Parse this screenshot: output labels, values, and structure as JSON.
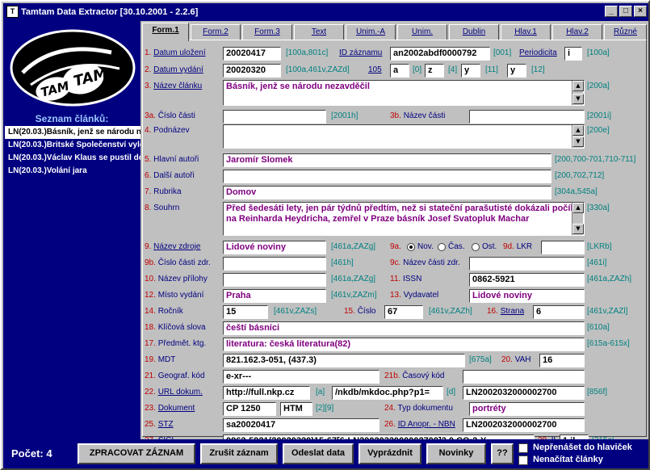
{
  "window": {
    "title": "Tamtam Data Extractor [30.10.2001 - 2.2.6]"
  },
  "sidebar": {
    "logo_text": "TAM TAM",
    "list_title": "Seznam článků:",
    "items": [
      "LN(20.03.)Básník, jenž se národu ne",
      "LN(20.03.)Britské Společenství vylo",
      "LN(20.03.)Václav Klaus se pustil do",
      "LN(20.03.)Volání jara"
    ]
  },
  "tabs": [
    "Form.1",
    "Form.2",
    "Form.3",
    "Text",
    "Unim.-A",
    "Unim.",
    "Dublin",
    "Hlav.1",
    "Hlav.2",
    "Různé"
  ],
  "form": {
    "r1": {
      "num": "1.",
      "label": "Datum uložení",
      "value": "20020417",
      "code": "[100a,801c]",
      "label2": "ID záznamu",
      "value2": "an2002abdf0000792",
      "code2": "[001]",
      "label3": "Periodicita",
      "value3": "i",
      "code3": "[100a]"
    },
    "r2": {
      "num": "2.",
      "label": "Datum vydání",
      "value": "20020320",
      "code": "[100a,461v,ZAZd]",
      "label2": "105",
      "v_a": "a",
      "c_a": "[0]",
      "v_z": "z",
      "c_z": "[4]",
      "v_y": "y",
      "c_y": "[11]",
      "v_y2": "y",
      "c_y2": "[12]"
    },
    "r3": {
      "num": "3.",
      "label": "Název článku",
      "value": "Básník, jenž se národu nezavděčil",
      "code": "[200a]"
    },
    "r3a": {
      "num": "3a.",
      "label": "Číslo části",
      "value": "",
      "code": "[2001h]",
      "num2": "3b.",
      "label2": "Název části",
      "value2": "",
      "code2": "[2001i]"
    },
    "r4": {
      "num": "4.",
      "label": "Podnázev",
      "value": "",
      "code": "[200e]"
    },
    "r5": {
      "num": "5.",
      "label": "Hlavní autoři",
      "value": "Jaromír Slomek",
      "code": "[200,700-701,710-711]"
    },
    "r6": {
      "num": "6.",
      "label": "Další autoři",
      "value": "",
      "code": "[200,702,712]"
    },
    "r7": {
      "num": "7.",
      "label": "Rubrika",
      "value": "Domov",
      "code": "[304a,545a]"
    },
    "r8": {
      "num": "8.",
      "label": "Souhrn",
      "value": "Před šedesáti lety, jen pár týdnů předtím, než si stateční parašutisté dokázali počíhat na Reinharda Heydricha, zemřel v Praze básník Josef Svatopluk Machar",
      "code": "[330a]"
    },
    "r9": {
      "num": "9.",
      "label": "Název zdroje",
      "value": "Lidové noviny",
      "code": "[461a,ZAZg]",
      "num2": "9a.",
      "r_nov": "Nov.",
      "r_cas": "Čas.",
      "r_ost": "Ost.",
      "num3": "9d.",
      "label3": "LKR",
      "value3": "",
      "code3": "[LKRb]"
    },
    "r9b": {
      "num": "9b.",
      "label": "Číslo části zdr.",
      "value": "",
      "code": "[461h]",
      "num2": "9c.",
      "label2": "Název části zdr.",
      "value2": "",
      "code2": "[461i]"
    },
    "r10": {
      "num": "10.",
      "label": "Název přílohy",
      "value": "",
      "code": "[461a,ZAZg]",
      "num2": "11.",
      "label2": "ISSN",
      "value2": "0862-5921",
      "code2": "[461a,ZAZh]"
    },
    "r12": {
      "num": "12.",
      "label": "Místo vydání",
      "value": "Praha",
      "code": "[461v,ZAZm]",
      "num2": "13.",
      "label2": "Vydavatel",
      "value2": "Lidové noviny"
    },
    "r14": {
      "num": "14.",
      "label": "Ročník",
      "value": "15",
      "code": "[461v,ZAZs]",
      "num2": "15.",
      "label2": "Číslo",
      "value2": "67",
      "code2": "[461v,ZAZh]",
      "num3": "16.",
      "label3": "Strana",
      "value3": "6",
      "code3": "[461v,ZAZl]"
    },
    "r18": {
      "num": "18.",
      "label": "Klíčová slova",
      "value": "čeští básníci",
      "code": "[610a]"
    },
    "r17": {
      "num": "17.",
      "label": "Předmět. ktg.",
      "value": "literatura: česká literatura(82)",
      "code": "[615a-615x]"
    },
    "r19": {
      "num": "19.",
      "label": "MDT",
      "value": "821.162.3-051, (437.3)",
      "code": "[675a]",
      "num2": "20.",
      "label2": "VAH",
      "value2": "16"
    },
    "r21": {
      "num": "21.",
      "label": "Geograf. kód",
      "value": "e-xr---",
      "num2": "21b.",
      "label2": "Časový kód",
      "value2": ""
    },
    "r22": {
      "num": "22.",
      "label": "URL dokum.",
      "value": "http://full.nkp.cz",
      "code": "[a]",
      "value_b": "/nkdb/mkdoc.php?p1=",
      "code_b": "[d]",
      "value_c": "LN2002032000002700",
      "code_c": "[856f]"
    },
    "r23": {
      "num": "23.",
      "label": "Dokument",
      "value": "CP 1250",
      "value_b": "HTM",
      "code": "[2][9]",
      "num2": "24.",
      "label2": "Typ dokumentu",
      "value2": "portréty"
    },
    "r25": {
      "num": "25.",
      "label": "STZ",
      "value": "sa20020417",
      "num2": "26.",
      "label2": "ID Anopr. - NBN",
      "value2": "LN2002032000002700"
    },
    "r27": {
      "num": "27.",
      "label": "SICI",
      "value": "0862-5921(20020320)15:67[6:LN2002032000002700]3.0.CO;2-Y",
      "num2": "28.",
      "label2": "IL",
      "value2": "1 il.",
      "code2": "[215c]"
    }
  },
  "bottom": {
    "count_label": "Počet: 4",
    "buttons": [
      "ZPRACOVAT ZÁZNAM",
      "Zrušit záznam",
      "Odeslat data",
      "Vyprázdnit",
      "Novinky",
      "??"
    ],
    "check1": "Nepřenášet do hlaviček",
    "check2": "Nenačítat články"
  }
}
